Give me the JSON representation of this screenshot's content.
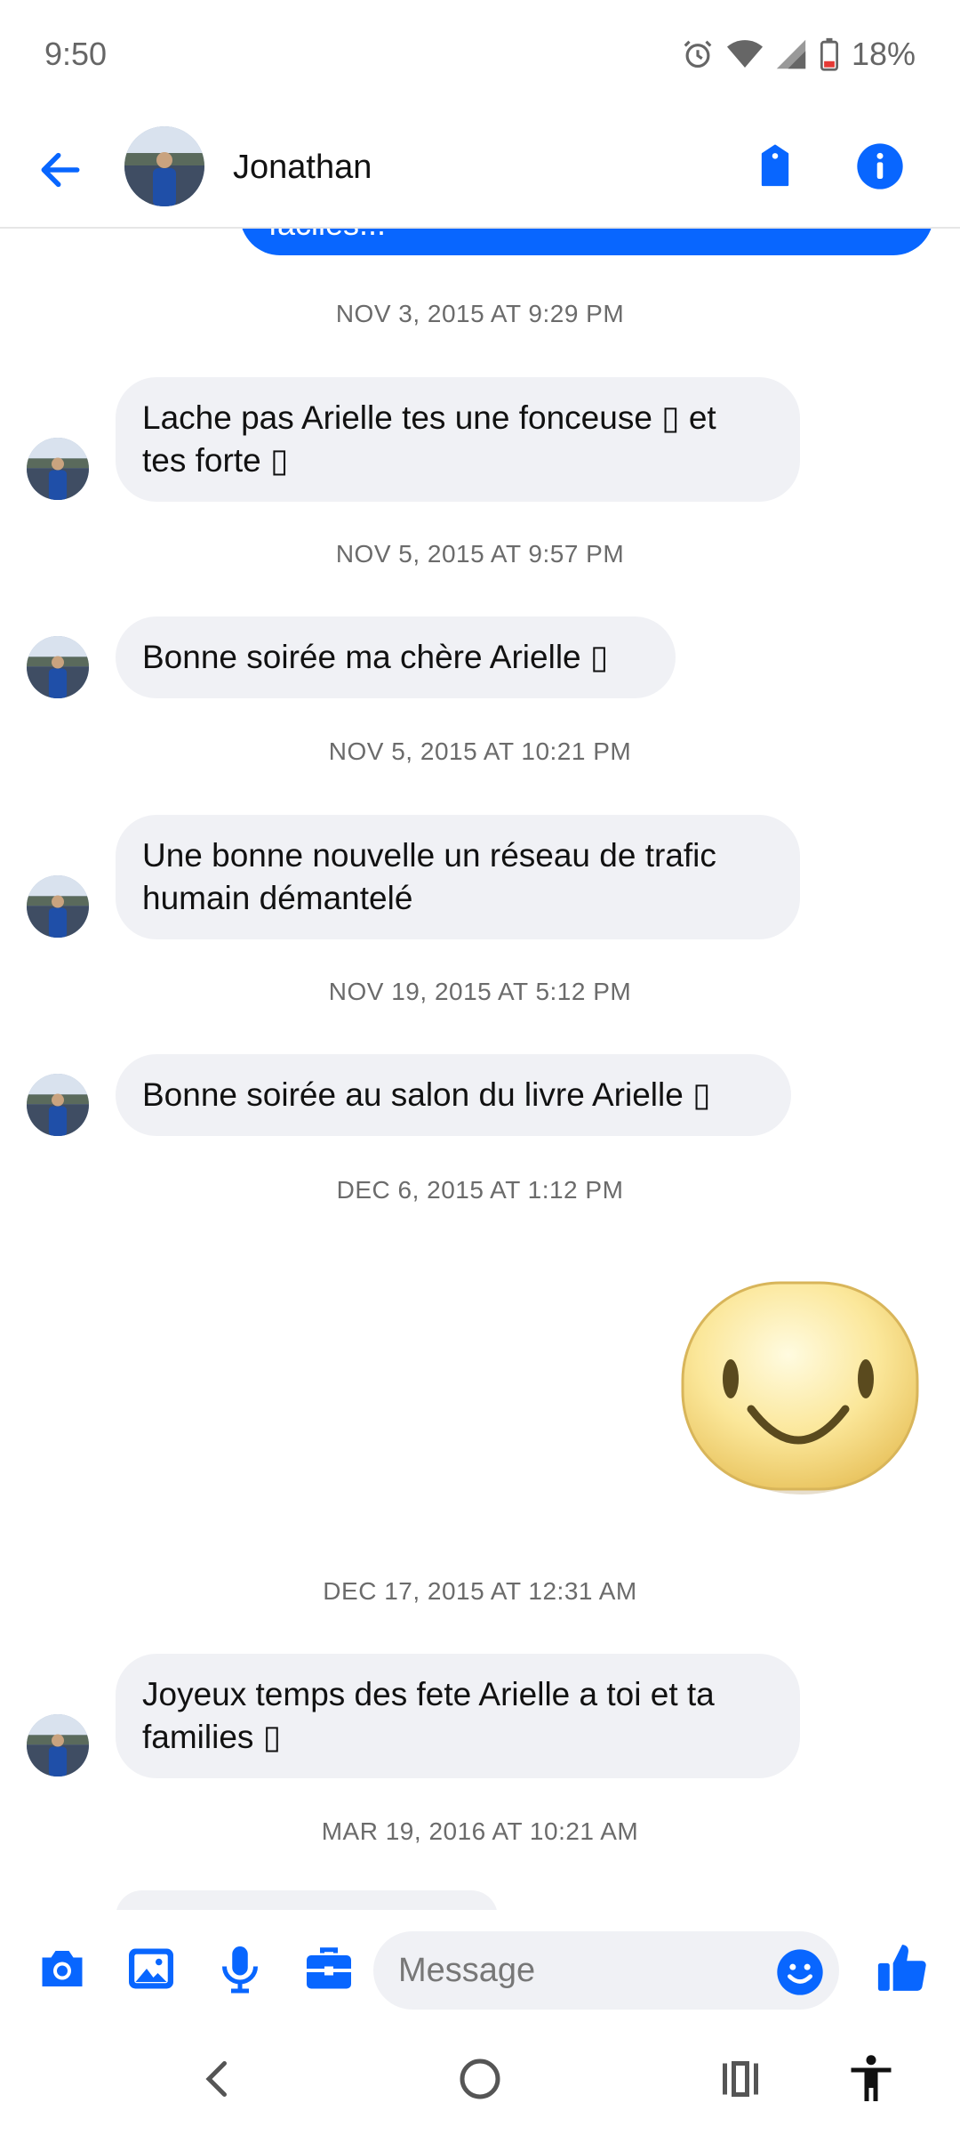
{
  "status_bar": {
    "time": "9:50",
    "battery": "18%",
    "icons": [
      "alarm-icon",
      "wifi-icon",
      "signal-icon",
      "battery-icon"
    ]
  },
  "header": {
    "contact_name": "Jonathan",
    "accent_color": "#0866ff"
  },
  "conversation": {
    "partial_sent_text": "faciles...",
    "items": [
      {
        "timestamp": "NOV 3, 2015 AT 9:29 PM",
        "lines": [
          "Lache pas Arielle tes une fonceuse ▯ et",
          "tes forte ▯"
        ]
      },
      {
        "timestamp": "NOV 5, 2015 AT 9:57 PM",
        "lines": [
          "Bonne soirée ma chère Arielle ▯"
        ]
      },
      {
        "timestamp": "NOV 5, 2015 AT 10:21 PM",
        "lines": [
          "Une bonne nouvelle un réseau de trafic",
          "humain démantelé"
        ]
      },
      {
        "timestamp": "NOV 19, 2015 AT 5:12 PM",
        "lines": [
          "Bonne soirée au salon du livre Arielle ▯"
        ]
      },
      {
        "timestamp": "DEC 6, 2015 AT 1:12 PM",
        "sticker": "smiley-sticker"
      },
      {
        "timestamp": "DEC 17, 2015 AT 12:31 AM",
        "lines": [
          "Joyeux temps des fete Arielle a toi et ta",
          "families ▯"
        ]
      },
      {
        "timestamp": "MAR 19, 2016 AT 10:21 AM"
      }
    ]
  },
  "composer": {
    "placeholder": "Message",
    "icons": [
      "camera-icon",
      "gallery-icon",
      "microphone-icon",
      "briefcase-icon",
      "emoji-icon",
      "thumbs-up-icon"
    ]
  },
  "navbar": {
    "icons": [
      "back-nav-icon",
      "home-nav-icon",
      "recents-nav-icon",
      "accessibility-icon"
    ]
  }
}
